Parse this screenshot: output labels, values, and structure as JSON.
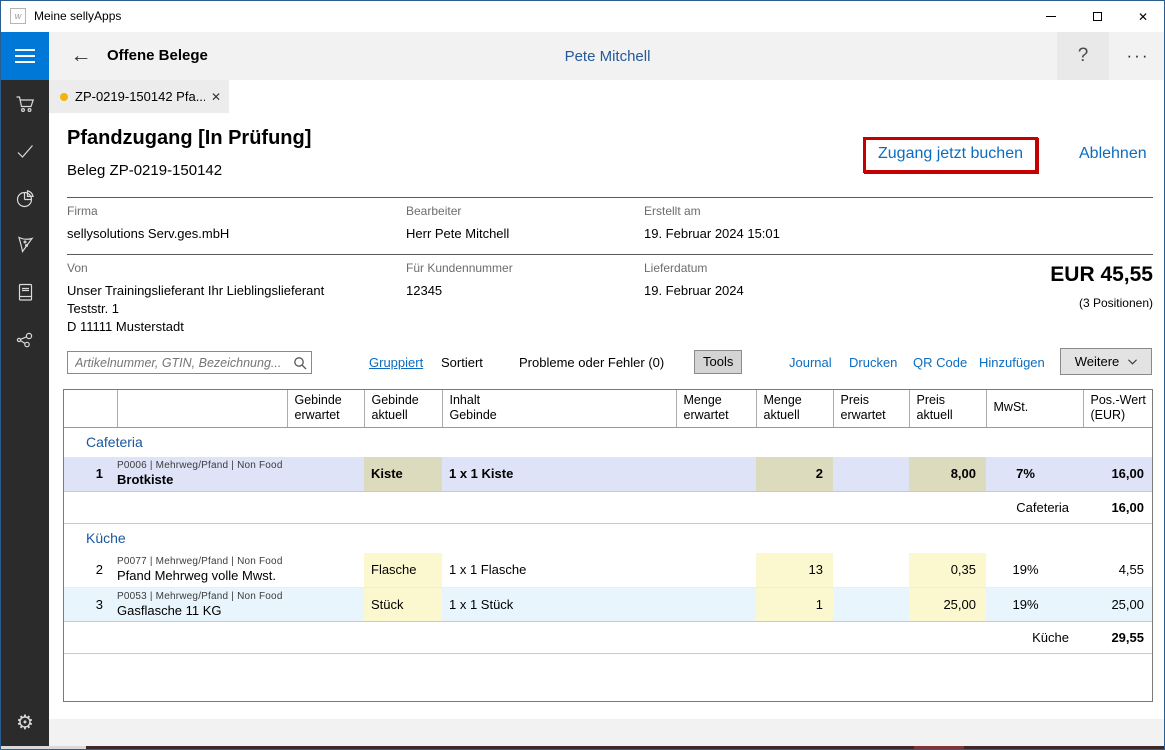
{
  "window": {
    "title": "Meine sellyApps"
  },
  "header": {
    "back": "←",
    "title": "Offene Belege",
    "user": "Pete Mitchell",
    "help": "?",
    "more": "···"
  },
  "tab": {
    "label": "ZP-0219-150142 Pfa...",
    "close": "✕"
  },
  "doc": {
    "title": "Pfandzugang [In Prüfung]",
    "beleg": "Beleg ZP-0219-150142",
    "action_book": "Zugang jetzt buchen",
    "action_reject": "Ablehnen",
    "fields": {
      "firma_label": "Firma",
      "firma": "sellysolutions Serv.ges.mbH",
      "bearbeiter_label": "Bearbeiter",
      "bearbeiter": "Herr Pete Mitchell",
      "erstellt_label": "Erstellt am",
      "erstellt": "19. Februar 2024 15:01",
      "von_label": "Von",
      "von_line1": "Unser Trainingslieferant Ihr Lieblingslieferant",
      "von_line2": "Teststr. 1",
      "von_line3": "D 11111 Musterstadt",
      "kundennr_label": "Für Kundennummer",
      "kundennr": "12345",
      "lieferdatum_label": "Lieferdatum",
      "lieferdatum": "19. Februar 2024"
    },
    "total": "EUR 45,55",
    "positions": "(3 Positionen)"
  },
  "toolbar": {
    "search_placeholder": "Artikelnummer, GTIN, Bezeichnung...",
    "grouped": "Gruppiert",
    "sorted": "Sortiert",
    "problems": "Probleme oder Fehler (0)",
    "tools": "Tools",
    "journal": "Journal",
    "print": "Drucken",
    "qr": "QR Code",
    "add": "Hinzufügen",
    "more": "Weitere"
  },
  "table": {
    "headers": [
      {
        "l1": "",
        "l2": ""
      },
      {
        "l1": "",
        "l2": ""
      },
      {
        "l1": "Gebinde",
        "l2": "erwartet"
      },
      {
        "l1": "Gebinde",
        "l2": "aktuell"
      },
      {
        "l1": "Inhalt",
        "l2": "Gebinde"
      },
      {
        "l1": "Menge",
        "l2": "erwartet"
      },
      {
        "l1": "Menge",
        "l2": "aktuell"
      },
      {
        "l1": "Preis",
        "l2": "erwartet"
      },
      {
        "l1": "Preis",
        "l2": "aktuell"
      },
      {
        "l1": "MwSt.",
        "l2": ""
      },
      {
        "l1": "Pos.-Wert",
        "l2": "(EUR)"
      }
    ],
    "groups": [
      {
        "name": "Cafeteria",
        "rows": [
          {
            "no": "1",
            "meta": "P0006 | Mehrweg/Pfand | Non Food",
            "name": "Brotkiste",
            "gebinde": "Kiste",
            "inhalt": "1 x 1 Kiste",
            "menge": "2",
            "preis": "8,00",
            "mwst": "7%",
            "wert": "16,00"
          }
        ],
        "subtotal_label": "Cafeteria",
        "subtotal": "16,00"
      },
      {
        "name": "Küche",
        "rows": [
          {
            "no": "2",
            "meta": "P0077 | Mehrweg/Pfand | Non Food",
            "name": "Pfand Mehrweg volle Mwst.",
            "gebinde": "Flasche",
            "inhalt": "1 x 1 Flasche",
            "menge": "13",
            "preis": "0,35",
            "mwst": "19%",
            "wert": "4,55"
          },
          {
            "no": "3",
            "meta": "P0053 | Mehrweg/Pfand | Non Food",
            "name": "Gasflasche 11 KG",
            "gebinde": "Stück",
            "inhalt": "1 x 1 Stück",
            "menge": "1",
            "preis": "25,00",
            "mwst": "19%",
            "wert": "25,00"
          }
        ],
        "subtotal_label": "Küche",
        "subtotal": "29,55"
      }
    ]
  },
  "icons": {
    "sidebar": [
      "menu",
      "cart",
      "check",
      "pie-chart",
      "pennant",
      "book",
      "share-network",
      "settings-gear"
    ]
  },
  "colors": {
    "titlebar_blue": "#0078d7",
    "link_blue": "#0d6cbf",
    "group_blue": "#1a57a0",
    "highlight_red": "#c40000",
    "selected_row": "#dee3f7",
    "cell_beige": "#dcdbbe",
    "cell_yellow": "#fbf8d0",
    "alt_row": "#e9f5fd"
  }
}
